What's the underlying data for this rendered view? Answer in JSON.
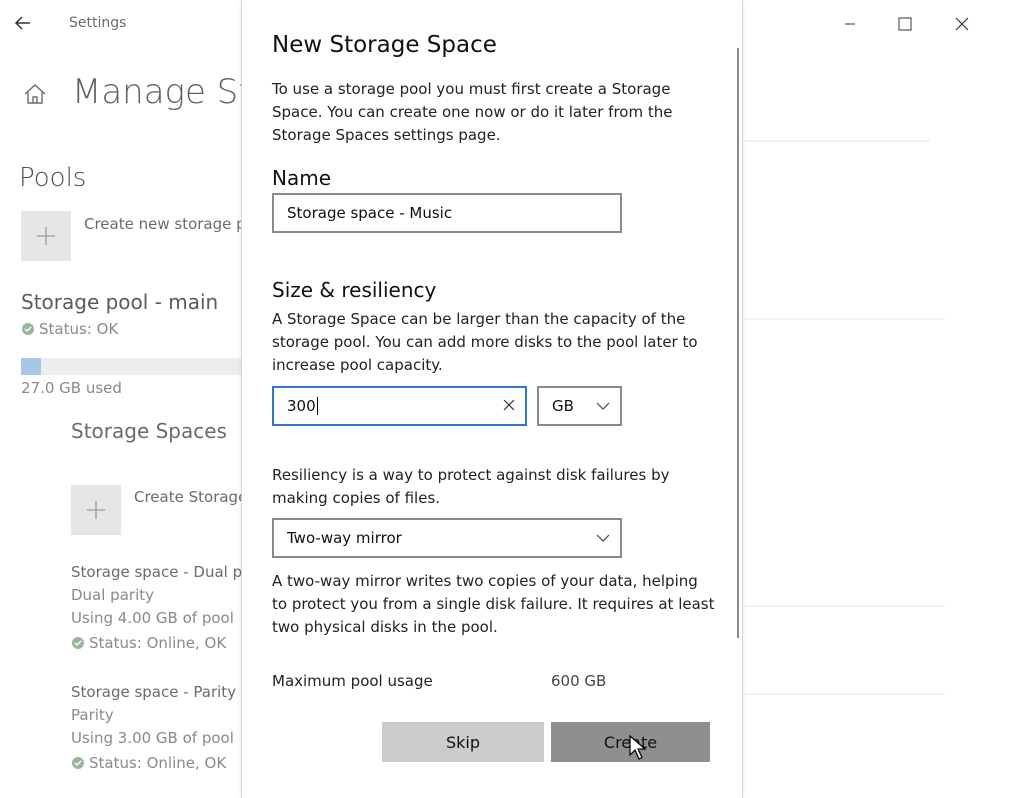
{
  "window": {
    "app_title": "Settings",
    "page_title": "Manage Sto"
  },
  "sidebar": {
    "pools_heading": "Pools",
    "create_pool_label": "Create new storage p",
    "pool": {
      "name": "Storage pool - main",
      "status": "Status: OK",
      "used": "27.0 GB used",
      "used_fraction": 0.09
    },
    "spaces_heading": "Storage Spaces",
    "create_space_label": "Create Storage",
    "spaces": [
      {
        "name": "Storage space - Dual p",
        "type": "Dual parity",
        "usage": "Using 4.00 GB of pool",
        "status": "Status: Online, OK"
      },
      {
        "name": "Storage space - Parity",
        "type": "Parity",
        "usage": "Using 3.00 GB of pool",
        "status": "Status: Online, OK"
      }
    ]
  },
  "dialog": {
    "title": "New Storage Space",
    "intro": "To use a storage pool you must first create a Storage Space. You can create one now or do it later from the Storage Spaces settings page.",
    "name_label": "Name",
    "name_value": "Storage space - Music",
    "size_heading": "Size & resiliency",
    "size_desc": "A Storage Space can be larger than the capacity of the storage pool. You can add more disks to the pool later to increase pool capacity.",
    "size_value": "300",
    "unit_value": "GB",
    "resiliency_desc": "Resiliency is a way to protect against disk failures by making copies of files.",
    "resiliency_value": "Two-way mirror",
    "mirror_desc": "A two-way mirror writes two copies of your data, helping to protect you from a single disk failure. It requires at least two physical disks in the pool.",
    "max_usage_label": "Maximum pool usage",
    "max_usage_value": "600 GB",
    "skip_label": "Skip",
    "create_label": "Create"
  },
  "colors": {
    "focus_border": "#2f76c5",
    "status_ok": "#9cb69c",
    "usage_fill": "#a7c6e8",
    "skip_bg": "#cccccc",
    "create_bg": "#8f8f8f"
  }
}
